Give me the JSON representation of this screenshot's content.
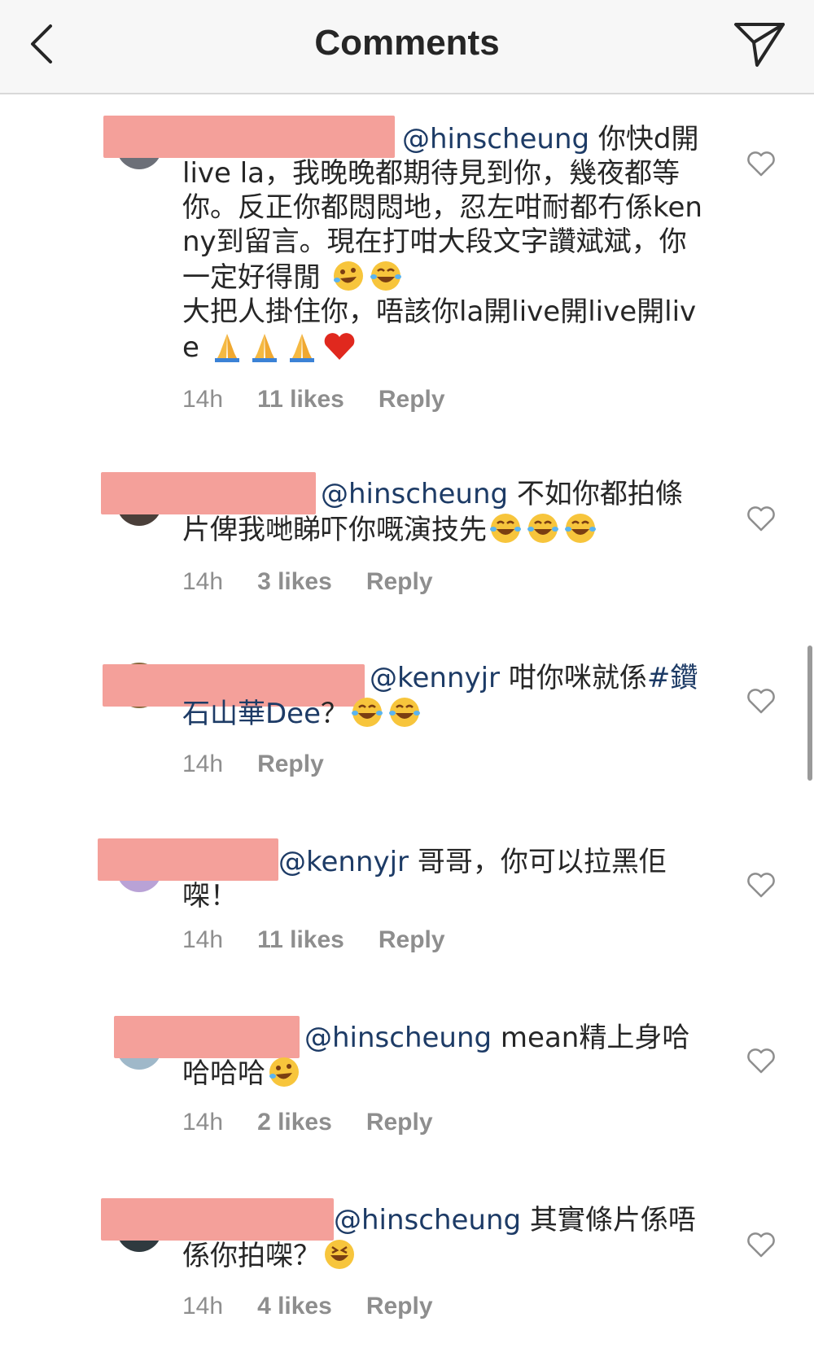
{
  "header": {
    "title": "Comments"
  },
  "comments": [
    {
      "mention": "@hinscheung",
      "text": " 你快d開live la，我晚晚都期待見到你，幾夜都等你。反正你都悶悶地，忍左咁耐都冇係kenny到留言。現在打咁大段文字讚斌斌，你一定好得閒",
      "text2": "大把人掛住你，唔該你la開live開live開live",
      "emojis1": [
        "rofl",
        "joy"
      ],
      "emojis2": [
        "pray",
        "pray",
        "pray",
        "heart"
      ],
      "time": "14h",
      "likes": "11 likes",
      "reply": "Reply"
    },
    {
      "mention": "@hinscheung",
      "text": " 不如你都拍條片俾我哋睇吓你嘅演技先",
      "emojis": [
        "joy",
        "joy",
        "joy"
      ],
      "time": "14h",
      "likes": "3 likes",
      "reply": "Reply"
    },
    {
      "mention": "@kennyjr",
      "text": " 咁你咪就係",
      "hashtag": "#鑽石山華Dee",
      "text_after": "？",
      "emojis": [
        "joy",
        "joy"
      ],
      "time": "14h",
      "reply": "Reply"
    },
    {
      "mention": "@kennyjr",
      "text": " 哥哥，你可以拉黑佢㗎！",
      "time": "14h",
      "likes": "11 likes",
      "reply": "Reply"
    },
    {
      "mention": "@hinscheung",
      "text": " mean精上身哈哈哈哈",
      "emojis": [
        "rofl"
      ],
      "time": "14h",
      "likes": "2 likes",
      "reply": "Reply"
    },
    {
      "mention": "@hinscheung",
      "text": " 其實條片係唔係你拍㗎？",
      "emojis": [
        "laughing"
      ],
      "time": "14h",
      "likes": "4 likes",
      "reply": "Reply"
    }
  ],
  "colors": {
    "mention": "#1d3b66",
    "meta": "#8e8e8e",
    "redaction": "#f4a09a",
    "header_bg": "#f7f7f7"
  },
  "icons": {
    "back": "chevron-left-icon",
    "share": "paper-plane-icon",
    "like": "heart-outline-icon"
  }
}
